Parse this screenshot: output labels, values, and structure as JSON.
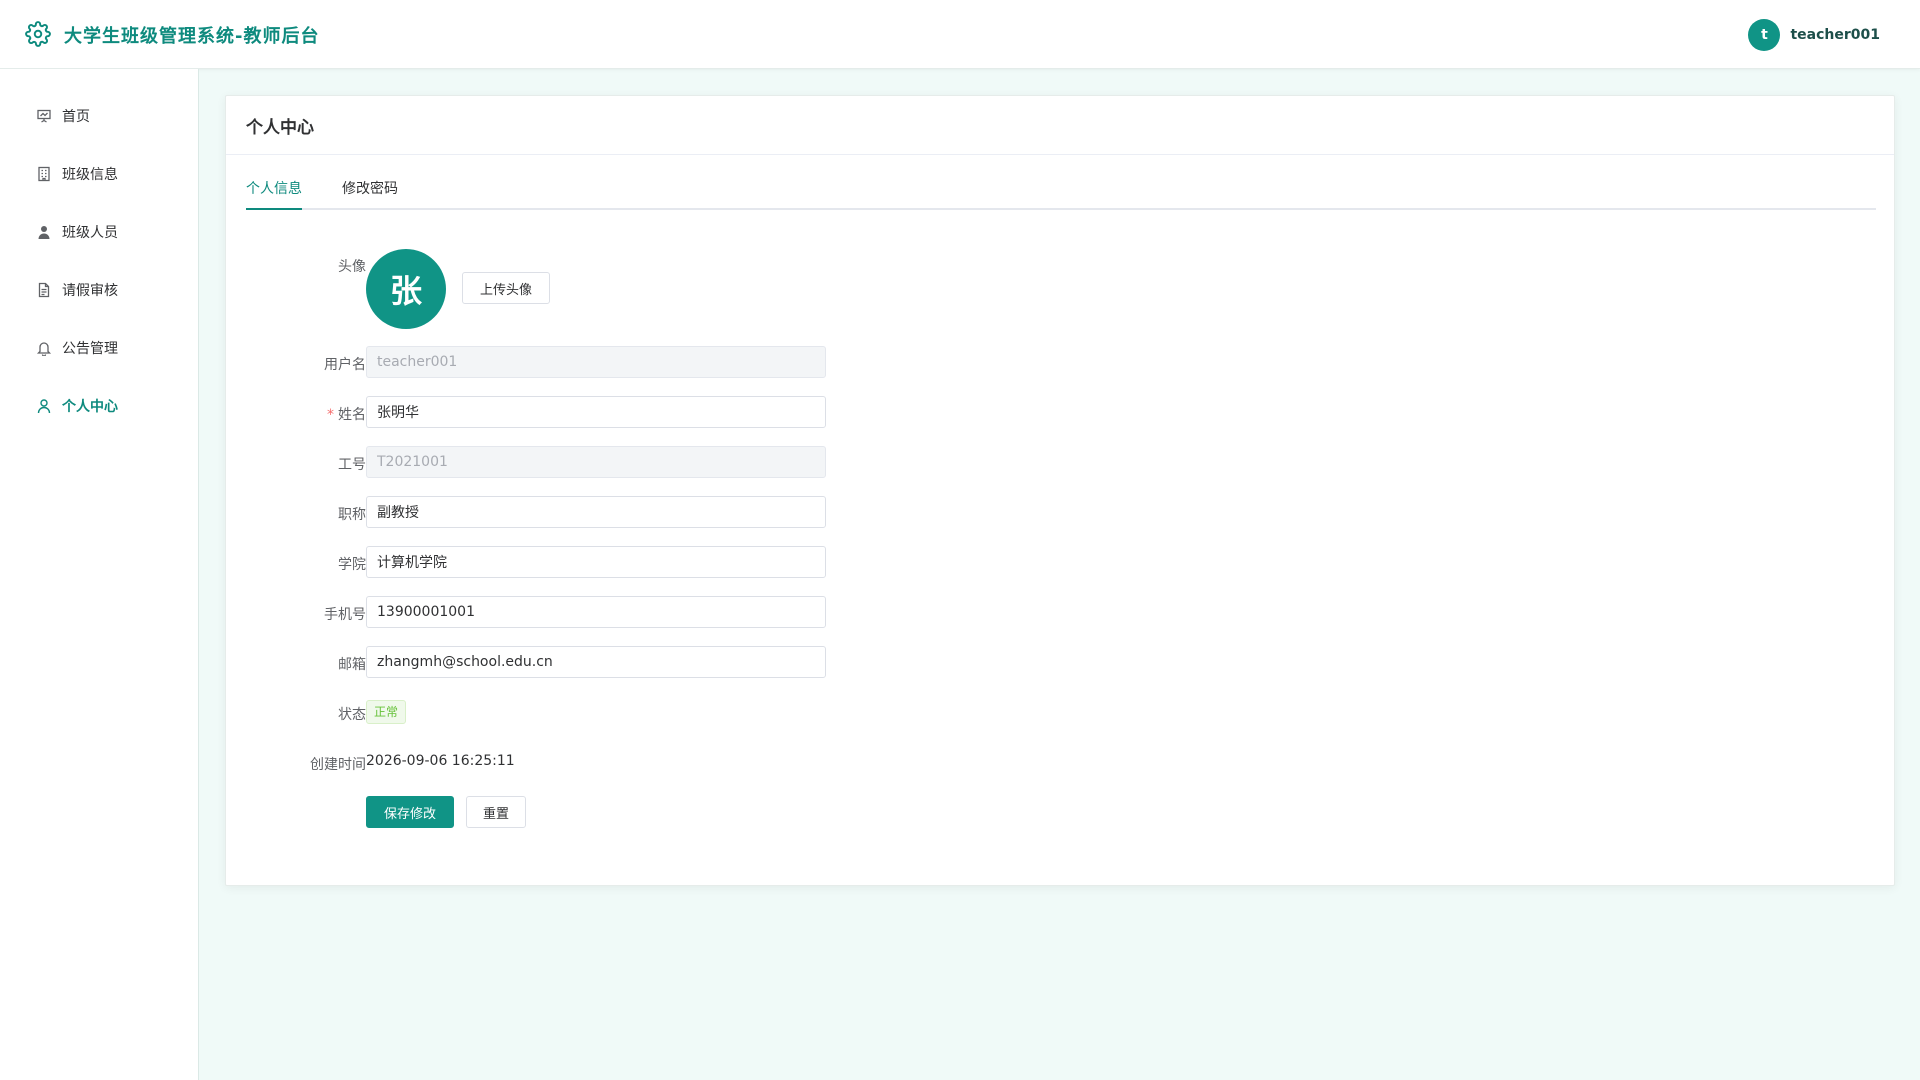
{
  "header": {
    "title": "大学生班级管理系统-教师后台",
    "logo_icon": "gear-icon",
    "user": {
      "avatar_letter": "t",
      "name": "teacher001"
    }
  },
  "sidebar": {
    "items": [
      {
        "label": "首页",
        "icon": "presentation-icon",
        "active": false
      },
      {
        "label": "班级信息",
        "icon": "building-icon",
        "active": false
      },
      {
        "label": "班级人员",
        "icon": "user-icon",
        "active": false
      },
      {
        "label": "请假审核",
        "icon": "document-icon",
        "active": false
      },
      {
        "label": "公告管理",
        "icon": "bell-icon",
        "active": false
      },
      {
        "label": "个人中心",
        "icon": "user-outline-icon",
        "active": true
      }
    ]
  },
  "card": {
    "title": "个人中心",
    "tabs": [
      {
        "label": "个人信息",
        "active": true
      },
      {
        "label": "修改密码",
        "active": false
      }
    ]
  },
  "form": {
    "avatar_label": "头像",
    "avatar_char": "张",
    "upload_label": "上传头像",
    "username_label": "用户名",
    "username_value": "teacher001",
    "name_label": "姓名",
    "name_value": "张明华",
    "staff_id_label": "工号",
    "staff_id_value": "T2021001",
    "title_label": "职称",
    "title_value": "副教授",
    "college_label": "学院",
    "college_value": "计算机学院",
    "phone_label": "手机号",
    "phone_value": "13900001001",
    "email_label": "邮箱",
    "email_value": "zhangmh@school.edu.cn",
    "status_label": "状态",
    "status_value": "正常",
    "created_label": "创建时间",
    "created_value": "2026-09-06 16:25:11",
    "save_label": "保存修改",
    "reset_label": "重置"
  },
  "colors": {
    "brand": "#109486",
    "status_success": "#67c23a",
    "background": "#f0faf8"
  }
}
